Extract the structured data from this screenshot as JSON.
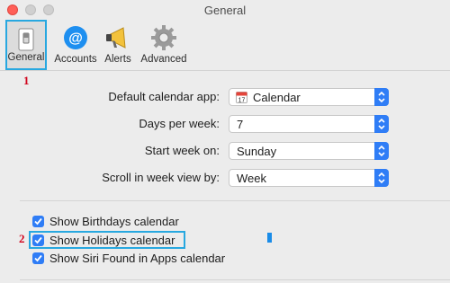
{
  "window": {
    "title": "General"
  },
  "toolbar": {
    "items": [
      {
        "label": "General",
        "icon": "general-switch-icon",
        "selected": true
      },
      {
        "label": "Accounts",
        "icon": "at-sign-icon"
      },
      {
        "label": "Alerts",
        "icon": "megaphone-icon"
      },
      {
        "label": "Advanced",
        "icon": "gear-icon"
      }
    ]
  },
  "annotations": {
    "marker_1": "1",
    "marker_2": "2"
  },
  "settings": {
    "default_calendar_app": {
      "label": "Default calendar app:",
      "value": "Calendar"
    },
    "days_per_week": {
      "label": "Days per week:",
      "value": "7"
    },
    "start_week_on": {
      "label": "Start week on:",
      "value": "Sunday"
    },
    "scroll_week_view": {
      "label": "Scroll in week view by:",
      "value": "Week"
    }
  },
  "checkboxes": [
    {
      "label": "Show Birthdays calendar",
      "checked": true
    },
    {
      "label": "Show Holidays calendar",
      "checked": true
    },
    {
      "label": "Show Siri Found in Apps calendar",
      "checked": true
    }
  ],
  "colors": {
    "accent": "#2f7df6",
    "highlight": "#28a8e0",
    "marker": "#d0021b"
  }
}
